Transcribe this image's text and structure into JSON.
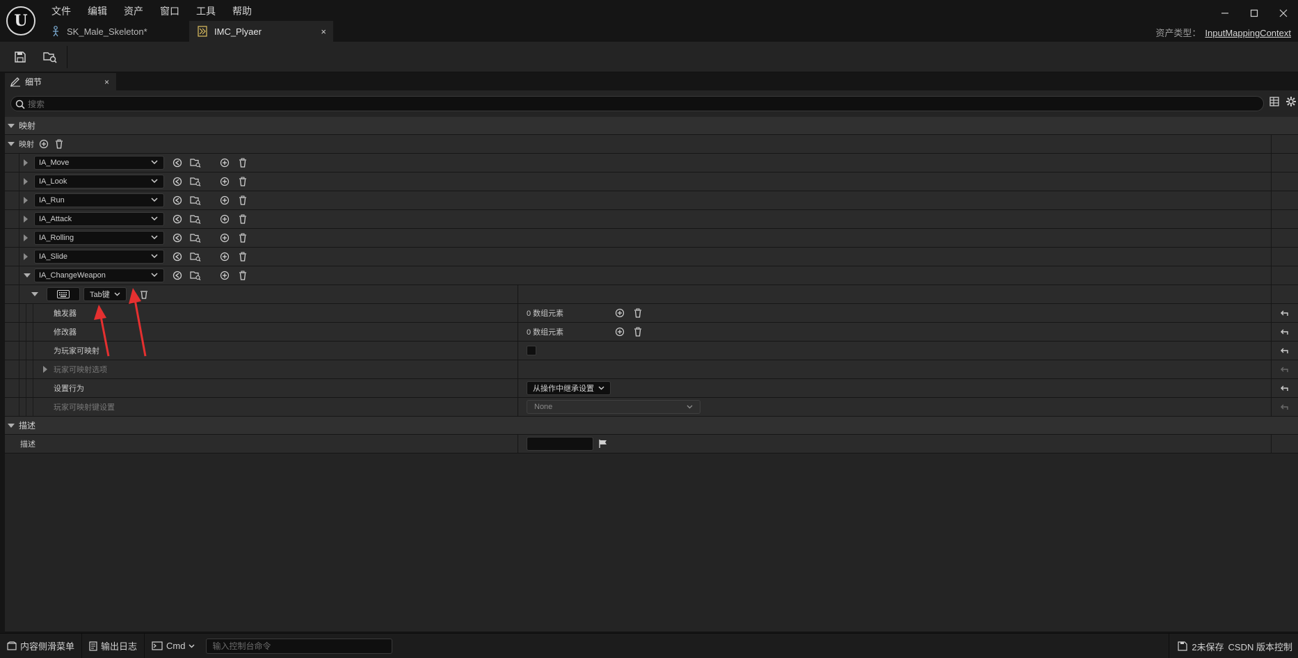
{
  "titlebar": {
    "logo_text": "U",
    "menu": [
      "文件",
      "编辑",
      "资产",
      "窗口",
      "工具",
      "帮助"
    ],
    "tabs": [
      {
        "label": "SK_Male_Skeleton*",
        "icon": "skeleton-icon"
      },
      {
        "label": "IMC_Plyaer",
        "icon": "input-mapping-icon",
        "close": "×"
      }
    ],
    "asset_type_label": "资产类型：",
    "asset_type_value": "InputMappingContext"
  },
  "toolbar": {
    "buttons": [
      "save-icon",
      "browse-to-asset-icon"
    ]
  },
  "panel": {
    "tab_label": "细节",
    "tab_close": "×",
    "search_placeholder": "搜索"
  },
  "sections": {
    "mapping_category": "映射",
    "mapping_array_label": "映射",
    "actions": [
      "IA_Move",
      "IA_Look",
      "IA_Run",
      "IA_Attack",
      "IA_Rolling",
      "IA_Slide",
      "IA_ChangeWeapon"
    ],
    "key_select": "Tab键",
    "triggers_label": "触发器",
    "triggers_value": "0 数组元素",
    "modifiers_label": "修改器",
    "modifiers_value": "0 数组元素",
    "player_mappable_label": "为玩家可映射",
    "player_mappable_options_label": "玩家可映射选项",
    "setting_behavior_label": "设置行为",
    "setting_behavior_value": "从操作中继承设置",
    "player_mappable_key_settings_label": "玩家可映射键设置",
    "player_mappable_key_settings_value": "None",
    "description_category": "描述",
    "description_label": "描述"
  },
  "statusbar": {
    "content_drawer": "内容侧滑菜单",
    "output_log": "输出日志",
    "cmd": "Cmd",
    "console_placeholder": "输入控制台命令",
    "unsaved": "2未保存",
    "source_control": "CSDN 版本控制"
  },
  "colors": {
    "background": "#151515",
    "panel": "#242424",
    "annotation_arrow": "#e53030"
  }
}
